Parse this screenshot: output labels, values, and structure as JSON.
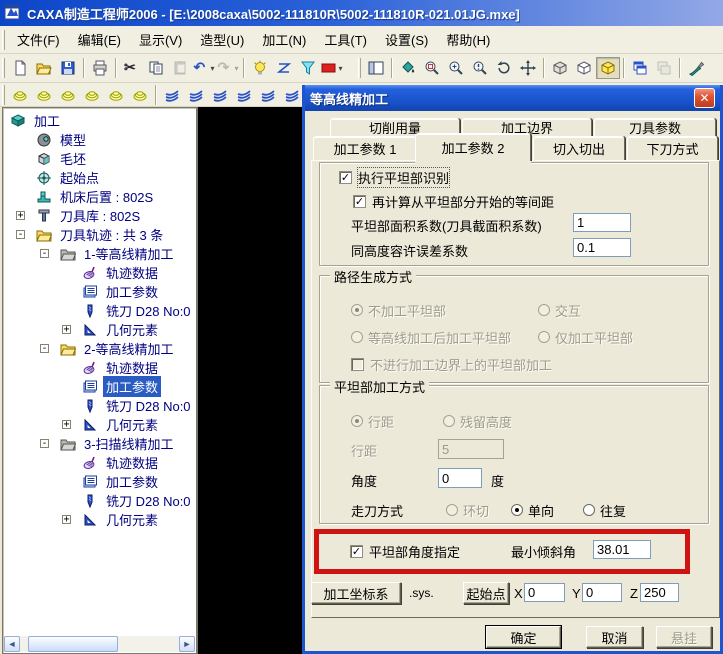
{
  "window": {
    "title": "CAXA制造工程师2006 - [E:\\2008caxa\\5002-111810R\\5002-111810R-021.01JG.mxe]"
  },
  "menus": [
    "文件(F)",
    "编辑(E)",
    "显示(V)",
    "造型(U)",
    "加工(N)",
    "工具(T)",
    "设置(S)",
    "帮助(H)"
  ],
  "toolbar_main": {
    "items": [
      {
        "grip": true
      },
      {
        "icon": "new-document-icon"
      },
      {
        "icon": "open-file-icon"
      },
      {
        "icon": "save-icon"
      },
      {
        "sep": true
      },
      {
        "icon": "print-icon"
      },
      {
        "sep": true
      },
      {
        "icon": "cut-icon"
      },
      {
        "icon": "copy-icon"
      },
      {
        "icon": "paste-icon",
        "disabled": true
      },
      {
        "icon": "undo-icon",
        "dropdown": true
      },
      {
        "icon": "redo-icon",
        "disabled": true,
        "dropdown": true
      },
      {
        "sep": true
      },
      {
        "icon": "render-mode-icon"
      },
      {
        "icon": "wireframe-mode-icon"
      },
      {
        "icon": "filter-icon"
      },
      {
        "icon": "color-swatch-icon",
        "dropdown": true
      },
      {
        "gap": true
      },
      {
        "grip": true
      },
      {
        "icon": "panel-toggle-icon"
      },
      {
        "sep": true
      },
      {
        "icon": "fill-color-icon"
      },
      {
        "icon": "zoom-window-icon"
      },
      {
        "icon": "zoom-in-icon"
      },
      {
        "icon": "zoom-dynamic-icon"
      },
      {
        "icon": "rotate-view-icon"
      },
      {
        "icon": "pan-view-icon"
      },
      {
        "sep": true
      },
      {
        "icon": "view-cube-shaded-icon"
      },
      {
        "icon": "view-cube-wire-icon"
      },
      {
        "icon": "view-cube-active-icon",
        "pressed": true
      },
      {
        "sep": true
      },
      {
        "icon": "cascade-windows-icon"
      },
      {
        "icon": "tile-windows-icon",
        "disabled": true
      },
      {
        "sep": true
      },
      {
        "icon": "brush-icon"
      }
    ]
  },
  "toolbar_machining": {
    "items": [
      {
        "grip": true
      },
      {
        "icon": "machining-op-1-icon",
        "variant": "yellow"
      },
      {
        "icon": "machining-op-2-icon",
        "variant": "yellow"
      },
      {
        "icon": "machining-op-3-icon",
        "variant": "yellow"
      },
      {
        "icon": "machining-op-4-icon",
        "variant": "yellow"
      },
      {
        "icon": "machining-op-5-icon",
        "variant": "yellow"
      },
      {
        "icon": "machining-op-6-icon",
        "variant": "yellow"
      },
      {
        "sep": true
      },
      {
        "icon": "machining-op-7-icon",
        "variant": "blue"
      },
      {
        "icon": "machining-op-8-icon",
        "variant": "blue"
      },
      {
        "icon": "machining-op-9-icon",
        "variant": "blue"
      },
      {
        "icon": "machining-op-10-icon",
        "variant": "blue"
      },
      {
        "icon": "machining-op-11-icon",
        "variant": "blue"
      },
      {
        "icon": "machining-op-12-icon",
        "variant": "blue"
      }
    ]
  },
  "tree": {
    "items": [
      {
        "label": "加工",
        "depth": 0,
        "icon": "process-root-icon",
        "expand": null
      },
      {
        "label": "模型",
        "depth": 1,
        "icon": "model-icon",
        "expand": null
      },
      {
        "label": "毛坯",
        "depth": 1,
        "icon": "blank-icon",
        "expand": null
      },
      {
        "label": "起始点",
        "depth": 1,
        "icon": "start-point-icon",
        "expand": null
      },
      {
        "label": "机床后置 : 802S",
        "depth": 1,
        "icon": "machine-post-icon",
        "expand": null
      },
      {
        "label": "刀具库 : 802S",
        "depth": 1,
        "icon": "tool-library-icon",
        "expand": "+"
      },
      {
        "label": "刀具轨迹 : 共 3 条",
        "depth": 1,
        "icon": "folder-yellow-icon",
        "expand": "-"
      },
      {
        "label": "1-等高线精加工",
        "depth": 2,
        "icon": "folder-gray-icon",
        "expand": "-"
      },
      {
        "label": "轨迹数据",
        "depth": 3,
        "icon": "trajectory-data-icon",
        "expand": null
      },
      {
        "label": "加工参数",
        "depth": 3,
        "icon": "machining-params-icon",
        "expand": null
      },
      {
        "label": "铣刀 D28 No:0",
        "depth": 3,
        "icon": "mill-tool-icon",
        "expand": null
      },
      {
        "label": "几何元素",
        "depth": 3,
        "icon": "geometry-icon",
        "expand": "+"
      },
      {
        "label": "2-等高线精加工",
        "depth": 2,
        "icon": "folder-yellow-icon",
        "expand": "-"
      },
      {
        "label": "轨迹数据",
        "depth": 3,
        "icon": "trajectory-data-icon",
        "expand": null
      },
      {
        "label": "加工参数",
        "depth": 3,
        "icon": "machining-params-icon",
        "expand": null,
        "selected": true
      },
      {
        "label": "铣刀 D28 No:0",
        "depth": 3,
        "icon": "mill-tool-icon",
        "expand": null
      },
      {
        "label": "几何元素",
        "depth": 3,
        "icon": "geometry-icon",
        "expand": "+"
      },
      {
        "label": "3-扫描线精加工",
        "depth": 2,
        "icon": "folder-gray-icon",
        "expand": "-"
      },
      {
        "label": "轨迹数据",
        "depth": 3,
        "icon": "trajectory-data-icon",
        "expand": null
      },
      {
        "label": "加工参数",
        "depth": 3,
        "icon": "machining-params-icon",
        "expand": null
      },
      {
        "label": "铣刀 D28 No:0",
        "depth": 3,
        "icon": "mill-tool-icon",
        "expand": null
      },
      {
        "label": "几何元素",
        "depth": 3,
        "icon": "geometry-icon",
        "expand": "+"
      }
    ]
  },
  "dialog": {
    "title": "等高线精加工",
    "close_label": "✕",
    "tabs_back": [
      "切削用量",
      "加工边界",
      "刀具参数"
    ],
    "tabs_front": [
      "加工参数 1",
      "加工参数 2",
      "切入切出",
      "下刀方式"
    ],
    "active_tab": "加工参数 2",
    "flat_section": {
      "cb1": "执行平坦部识别",
      "cb2": "再计算从平坦部分开始的等间距",
      "area_label": "平坦部面积系数(刀具截面积系数)",
      "area_value": "1",
      "tol_label": "同高度容许误差系数",
      "tol_value": "0.1"
    },
    "path_group": {
      "title": "路径生成方式",
      "radios": [
        "不加工平坦部",
        "交互",
        "等高线加工后加工平坦部",
        "仅加工平坦部"
      ],
      "checkbox": "不进行加工边界上的平坦部加工"
    },
    "flat_machining_group": {
      "title": "平坦部加工方式",
      "radio_row": [
        "行距",
        "残留高度"
      ],
      "row_spacing_label": "行距",
      "row_spacing_value": "5",
      "angle_label": "角度",
      "angle_value": "0",
      "angle_unit": "度",
      "cut_mode_label": "走刀方式",
      "cut_modes": [
        "环切",
        "单向",
        "往复"
      ]
    },
    "angle_spec": {
      "checkbox": "平坦部角度指定",
      "min_angle_label": "最小倾斜角",
      "min_angle_value": "38.01",
      "highlight_color": "#ce1312"
    },
    "coord_row": {
      "coord_button": "加工坐标系",
      "sys_label": ".sys.",
      "origin_button": "起始点",
      "x_label": "X",
      "x_value": "0",
      "y_label": "Y",
      "y_value": "0",
      "z_label": "Z",
      "z_value": "250"
    },
    "buttons": {
      "ok": "确定",
      "cancel": "取消",
      "suspend": "悬挂"
    }
  }
}
